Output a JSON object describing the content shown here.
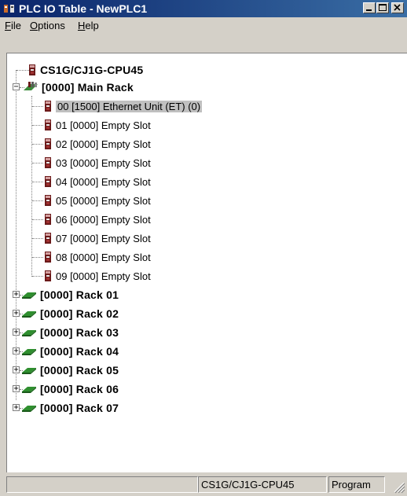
{
  "window": {
    "title": "PLC IO Table - NewPLC1",
    "icons": {
      "app": "plc-io-table-icon",
      "minimize": "minimize-icon",
      "maximize": "maximize-icon",
      "close": "close-icon"
    }
  },
  "menu": {
    "file": {
      "accel": "F",
      "rest": "ile"
    },
    "options": {
      "accel": "O",
      "rest": "ptions"
    },
    "help": {
      "accel": "H",
      "rest": "elp"
    }
  },
  "tree": {
    "cpu": {
      "label": "CS1G/CJ1G-CPU45",
      "icon": "cpu-unit-icon"
    },
    "main_rack": {
      "label": "[0000] Main Rack",
      "expanded": true,
      "icon": "main-rack-icon",
      "slots": [
        {
          "label": "00 [1500] Ethernet Unit (ET) (0)",
          "selected": true
        },
        {
          "label": "01 [0000] Empty Slot"
        },
        {
          "label": "02 [0000] Empty Slot"
        },
        {
          "label": "03 [0000] Empty Slot"
        },
        {
          "label": "04 [0000] Empty Slot"
        },
        {
          "label": "05 [0000] Empty Slot"
        },
        {
          "label": "06 [0000] Empty Slot"
        },
        {
          "label": "07 [0000] Empty Slot"
        },
        {
          "label": "08 [0000] Empty Slot"
        },
        {
          "label": "09 [0000] Empty Slot"
        }
      ]
    },
    "racks": [
      {
        "label": "[0000] Rack 01",
        "expanded": false
      },
      {
        "label": "[0000] Rack 02",
        "expanded": false
      },
      {
        "label": "[0000] Rack 03",
        "expanded": false
      },
      {
        "label": "[0000] Rack 04",
        "expanded": false
      },
      {
        "label": "[0000] Rack 05",
        "expanded": false
      },
      {
        "label": "[0000] Rack 06",
        "expanded": false
      },
      {
        "label": "[0000] Rack 07",
        "expanded": false
      }
    ]
  },
  "status": {
    "cpu": "CS1G/CJ1G-CPU45",
    "mode": "Program"
  }
}
